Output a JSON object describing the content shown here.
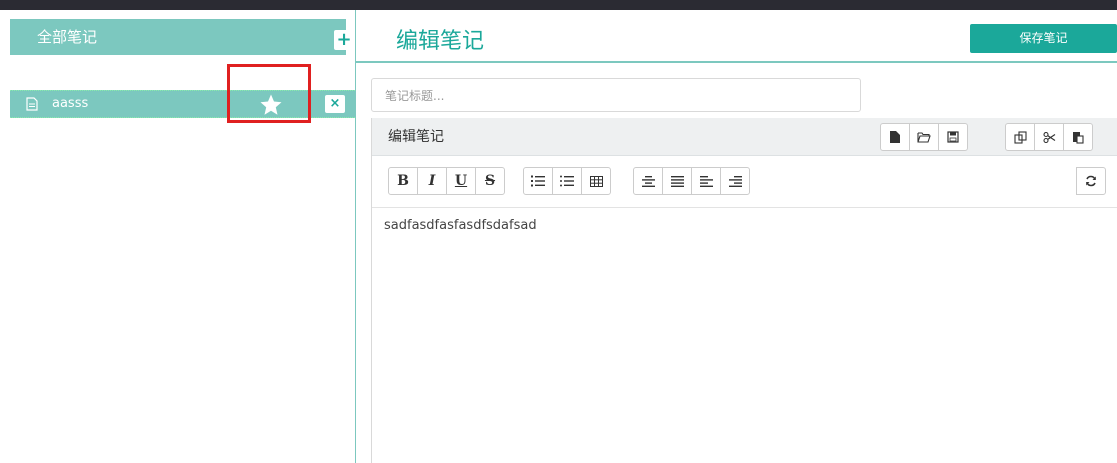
{
  "sidebar": {
    "header_title": "全部笔记",
    "add_label": "+",
    "notes": [
      {
        "title": "aasss",
        "delete_label": "×"
      }
    ]
  },
  "main": {
    "page_title": "编辑笔记",
    "save_label": "保存笔记",
    "title_placeholder": "笔记标题...",
    "editor_title": "编辑笔记",
    "toolbar": {
      "bold": "B",
      "italic": "I",
      "underline": "U",
      "strike": "S"
    },
    "content": "sadfasdfasfasdfsdafsad"
  },
  "colors": {
    "accent": "#1ba89a",
    "sidebar_header": "#7cc8bf",
    "highlight": "#e02020"
  }
}
